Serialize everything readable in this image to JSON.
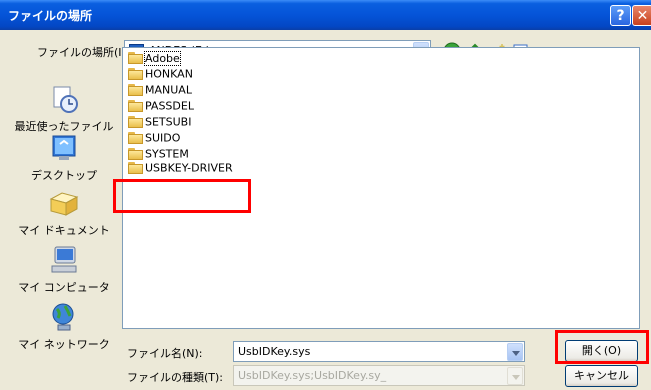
{
  "title": "ファイルの場所",
  "help_glyph": "?",
  "close_glyph": "✕",
  "look_in": {
    "label": "ファイルの場所(I):",
    "value": "ANDES (E:)"
  },
  "places": [
    {
      "label": "最近使ったファイル",
      "icon": "recent-icon"
    },
    {
      "label": "デスクトップ",
      "icon": "desktop-icon"
    },
    {
      "label": "マイ ドキュメント",
      "icon": "my-documents-icon"
    },
    {
      "label": "マイ コンピュータ",
      "icon": "my-computer-icon"
    },
    {
      "label": "マイ ネットワーク",
      "icon": "my-network-icon"
    }
  ],
  "files": [
    {
      "name": "Adobe"
    },
    {
      "name": "HONKAN"
    },
    {
      "name": "MANUAL"
    },
    {
      "name": "PASSDEL"
    },
    {
      "name": "SETSUBI"
    },
    {
      "name": "SUIDO"
    },
    {
      "name": "SYSTEM"
    },
    {
      "name": "USBKEY-DRIVER"
    }
  ],
  "filename": {
    "label": "ファイル名(N):",
    "value": "UsbIDKey.sys"
  },
  "filetype": {
    "label": "ファイルの種類(T):",
    "value": "UsbIDKey.sys;UsbIDKey.sy_"
  },
  "buttons": {
    "open": "開く(O)",
    "cancel": "キャンセル"
  },
  "colors": {
    "titlebar": "#0554d8",
    "highlight": "#ff0000",
    "dialog_bg": "#ece9d8"
  }
}
